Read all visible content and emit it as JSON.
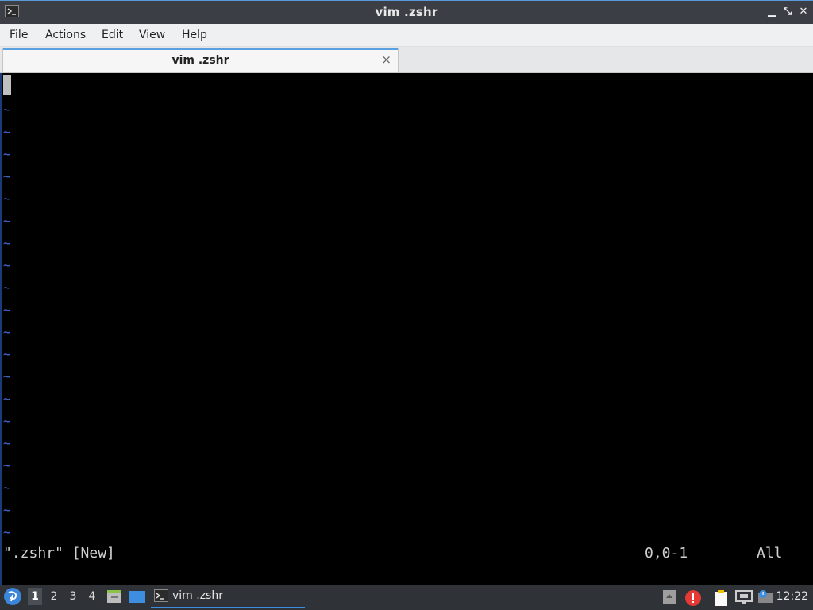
{
  "window": {
    "title": "vim .zshr",
    "controls": [
      "minimize-icon",
      "maximize-icon",
      "close-icon"
    ]
  },
  "menu": {
    "items": [
      "File",
      "Actions",
      "Edit",
      "View",
      "Help"
    ]
  },
  "tabs": [
    {
      "label": "vim .zshr",
      "close_symbol": "×"
    }
  ],
  "terminal": {
    "tilde": "~",
    "status_file": "\".zshr\" [New]",
    "status_pos": "0,0-1",
    "status_scroll": "All"
  },
  "taskbar": {
    "workspaces": [
      "1",
      "2",
      "3",
      "4"
    ],
    "active_workspace": "1",
    "task_label": "vim .zshr",
    "clock": "12:22",
    "tray_icons": [
      "upload-icon",
      "alert-icon",
      "clipboard-icon",
      "network-icon",
      "update-icon"
    ]
  },
  "colors": {
    "titlebar": "#3b3f45",
    "menubar": "#eff0f1",
    "terminal_bg": "#000000",
    "vim_tilde": "#4a6ee0",
    "taskbar": "#2f3338",
    "accent": "#3d8de0"
  }
}
